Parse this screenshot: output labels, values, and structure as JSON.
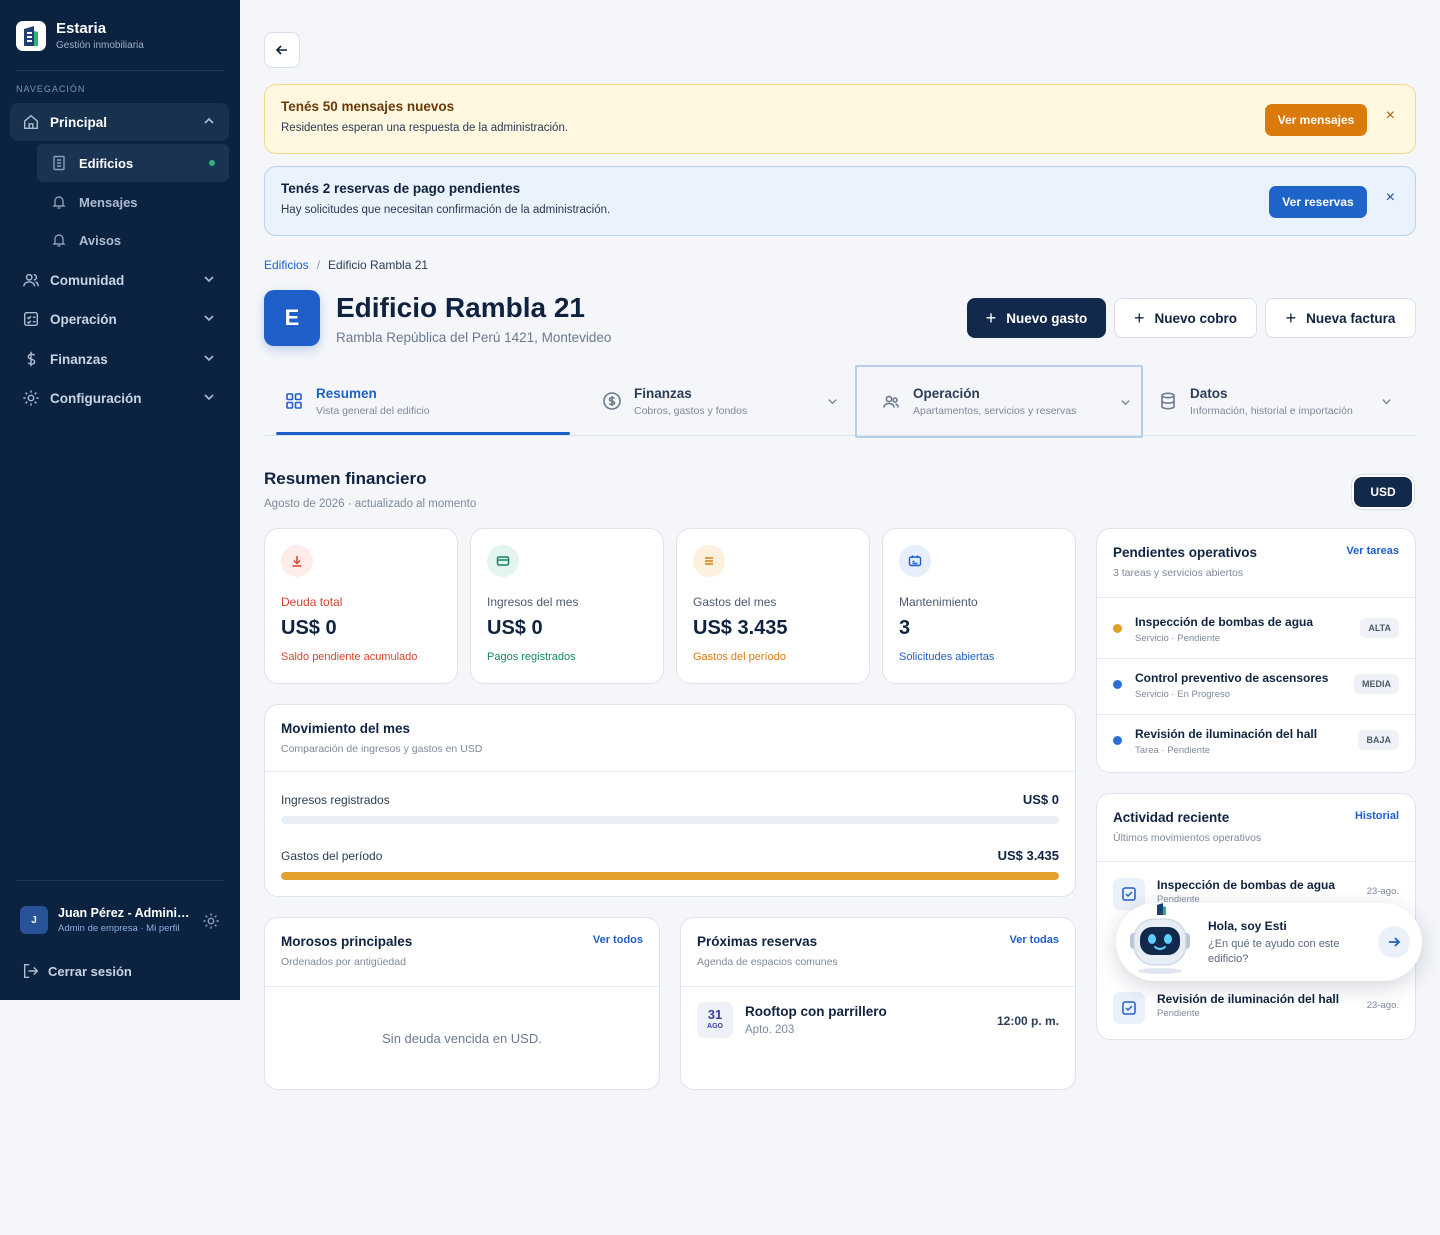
{
  "brand": {
    "name": "Estaria",
    "subtitle": "Gestión inmobiliaria"
  },
  "sidebar": {
    "heading": "NAVEGACIÓN",
    "principal": "Principal",
    "sub": [
      {
        "label": "Edificios"
      },
      {
        "label": "Mensajes"
      },
      {
        "label": "Avisos"
      }
    ],
    "groups": [
      {
        "label": "Comunidad"
      },
      {
        "label": "Operación"
      },
      {
        "label": "Finanzas"
      },
      {
        "label": "Configuración"
      }
    ],
    "user": {
      "initial": "J",
      "name": "Juan Pérez - Administrador",
      "role": "Admin de empresa · Mi perfil"
    },
    "logout": "Cerrar sesión"
  },
  "alerts": [
    {
      "title": "Tenés 50 mensajes nuevos",
      "text": "Residentes esperan una respuesta de la administración.",
      "button": "Ver mensajes",
      "close": "×"
    },
    {
      "title": "Tenés 2 reservas de pago pendientes",
      "text": "Hay solicitudes que necesitan confirmación de la administración.",
      "button": "Ver reservas",
      "close": "×"
    }
  ],
  "breadcrumb": {
    "root": "Edificios",
    "sep": "/",
    "current": "Edificio Rambla 21"
  },
  "building": {
    "initial": "E",
    "name": "Edificio Rambla 21",
    "address": "Rambla República del Perú 1421, Montevideo"
  },
  "actions": {
    "plus": "+",
    "new_expense": "Nuevo gasto",
    "new_charge": "Nuevo cobro",
    "new_invoice": "Nueva factura"
  },
  "tabs": [
    {
      "label": "Resumen",
      "desc": "Vista general del edificio"
    },
    {
      "label": "Finanzas",
      "desc": "Cobros, gastos y fondos"
    },
    {
      "label": "Operación",
      "desc": "Apartamentos, servicios y reservas"
    },
    {
      "label": "Datos",
      "desc": "Información, historial e importación"
    }
  ],
  "summary": {
    "title": "Resumen financiero",
    "subtitle": "Agosto de 2026 · actualizado al momento",
    "currency": "USD"
  },
  "kpis": [
    {
      "label": "Deuda total",
      "value": "US$ 0",
      "note": "Saldo pendiente acumulado",
      "color": "#d2442f"
    },
    {
      "label": "Ingresos del mes",
      "value": "US$ 0",
      "note": "Pagos registrados",
      "color": "#16875a"
    },
    {
      "label": "Gastos del mes",
      "value": "US$ 3.435",
      "note": "Gastos del período",
      "color": "#d97a0b"
    },
    {
      "label": "Mantenimiento",
      "value": "3",
      "note": "Solicitudes abiertas",
      "color": "#1f5fc9"
    }
  ],
  "movement": {
    "title": "Movimiento del mes",
    "subtitle": "Comparación de ingresos y gastos en USD",
    "rows": [
      {
        "label": "Ingresos registrados",
        "value": "US$ 0",
        "fill": 0
      },
      {
        "label": "Gastos del período",
        "value": "US$ 3.435",
        "fill": 1
      }
    ]
  },
  "debtors": {
    "title": "Morosos principales",
    "subtitle": "Ordenados por antigüedad",
    "link": "Ver todos",
    "empty": "Sin deuda vencida en USD."
  },
  "bookings": {
    "title": "Próximas reservas",
    "subtitle": "Agenda de espacios comunes",
    "link": "Ver todas",
    "items": [
      {
        "day": "31",
        "month": "AGO",
        "name": "Rooftop con parrillero",
        "unit": "Apto. 203",
        "time": "12:00 p. m."
      }
    ]
  },
  "pending": {
    "title": "Pendientes operativos",
    "subtitle": "3 tareas y servicios abiertos",
    "link": "Ver tareas",
    "items": [
      {
        "name": "Inspección de bombas de agua",
        "meta": "Servicio · Pendiente",
        "badge": "ALTA",
        "color": "#e0a028"
      },
      {
        "name": "Control preventivo de ascensores",
        "meta": "Servicio · En Progreso",
        "badge": "MEDIA",
        "color": "#2b6fd6"
      },
      {
        "name": "Revisión de iluminación del hall",
        "meta": "Tarea · Pendiente",
        "badge": "BAJA",
        "color": "#2b6fd6"
      }
    ]
  },
  "activity": {
    "title": "Actividad reciente",
    "subtitle": "Últimos movimientos operativos",
    "link": "Historial",
    "items": [
      {
        "name": "Inspección de bombas de agua",
        "meta": "Pendiente",
        "date": "23-ago."
      },
      {
        "name": "Revisión de iluminación del hall",
        "meta": "Pendiente",
        "date": "23-ago."
      }
    ]
  },
  "assistant": {
    "title": "Hola, soy Esti",
    "text": "¿En qué te ayudo con este edificio?"
  }
}
